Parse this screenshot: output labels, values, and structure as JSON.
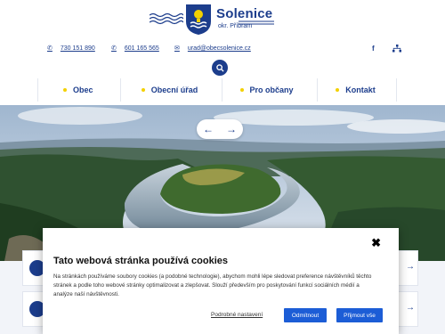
{
  "site": {
    "name": "Solenice",
    "subtitle": "okr. Příbram"
  },
  "contacts": {
    "phone1": "730 151 890",
    "phone2": "601 165 565",
    "email": "urad@obecsolenice.cz",
    "phone_icon": "✆",
    "email_icon": "✉"
  },
  "social": {
    "facebook": "f",
    "sitemap_icon": "sitemap-icon"
  },
  "nav": {
    "items": [
      {
        "label": "Obec"
      },
      {
        "label": "Obecní úřad"
      },
      {
        "label": "Pro občany"
      },
      {
        "label": "Kontakt"
      }
    ]
  },
  "slider": {
    "prev": "←",
    "next": "→"
  },
  "cards": {
    "arrow": "→"
  },
  "cookie": {
    "close": "✖",
    "title": "Tato webová stránka používá cookies",
    "text": "Na stránkách používáme soubory cookies (a podobné technologie), abychom mohli lépe sledovat preference návštěvníků těchto stránek a podle toho webové stránky optimalizovat a zlepšovat. Slouží především pro poskytování funkcí sociálních médií a analýze naší návštěvnosti.",
    "settings_link": "Podrobné nastavení",
    "reject": "Odmítnout",
    "accept": "Přijmout vše"
  },
  "colors": {
    "brand": "#1c3d8c",
    "accent": "#f3d100",
    "button": "#1c5dd6"
  }
}
